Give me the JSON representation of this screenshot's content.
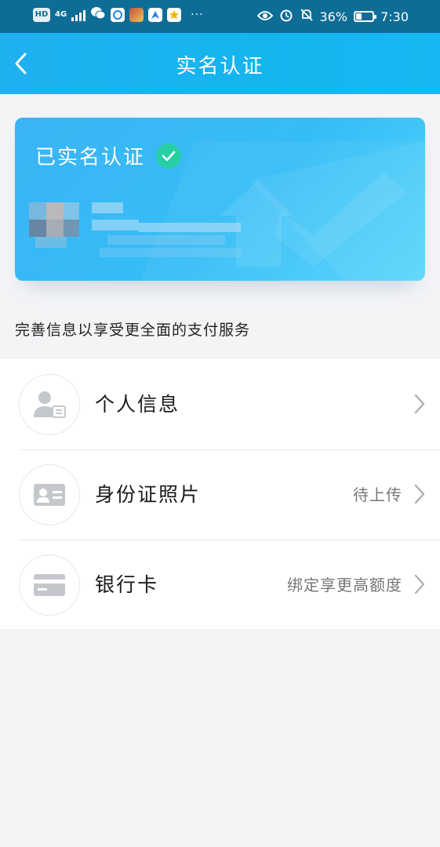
{
  "status_bar": {
    "hd_label": "HD",
    "network_label": "4G",
    "battery_percent": "36%",
    "battery_level": 0.36,
    "time": "7:30",
    "more_label": "···"
  },
  "nav": {
    "title": "实名认证",
    "back_icon": "chevron-left-icon"
  },
  "card": {
    "verified_text": "已实名认证",
    "verified_icon": "check-circle-icon",
    "gradient_start": "#3bb4f5",
    "gradient_end": "#52d4fb"
  },
  "subtitle": "完善信息以享受更全面的支付服务",
  "items": [
    {
      "label": "个人信息",
      "status": "",
      "icon": "user-profile-icon"
    },
    {
      "label": "身份证照片",
      "status": "待上传",
      "icon": "id-card-icon"
    },
    {
      "label": "银行卡",
      "status": "绑定享更高额度",
      "icon": "bank-card-icon"
    }
  ],
  "colors": {
    "header_blue": "#14b5ef",
    "status_bar": "#0e6d96",
    "verified_green": "#28cfa4",
    "icon_gray": "#c4c8cc"
  }
}
